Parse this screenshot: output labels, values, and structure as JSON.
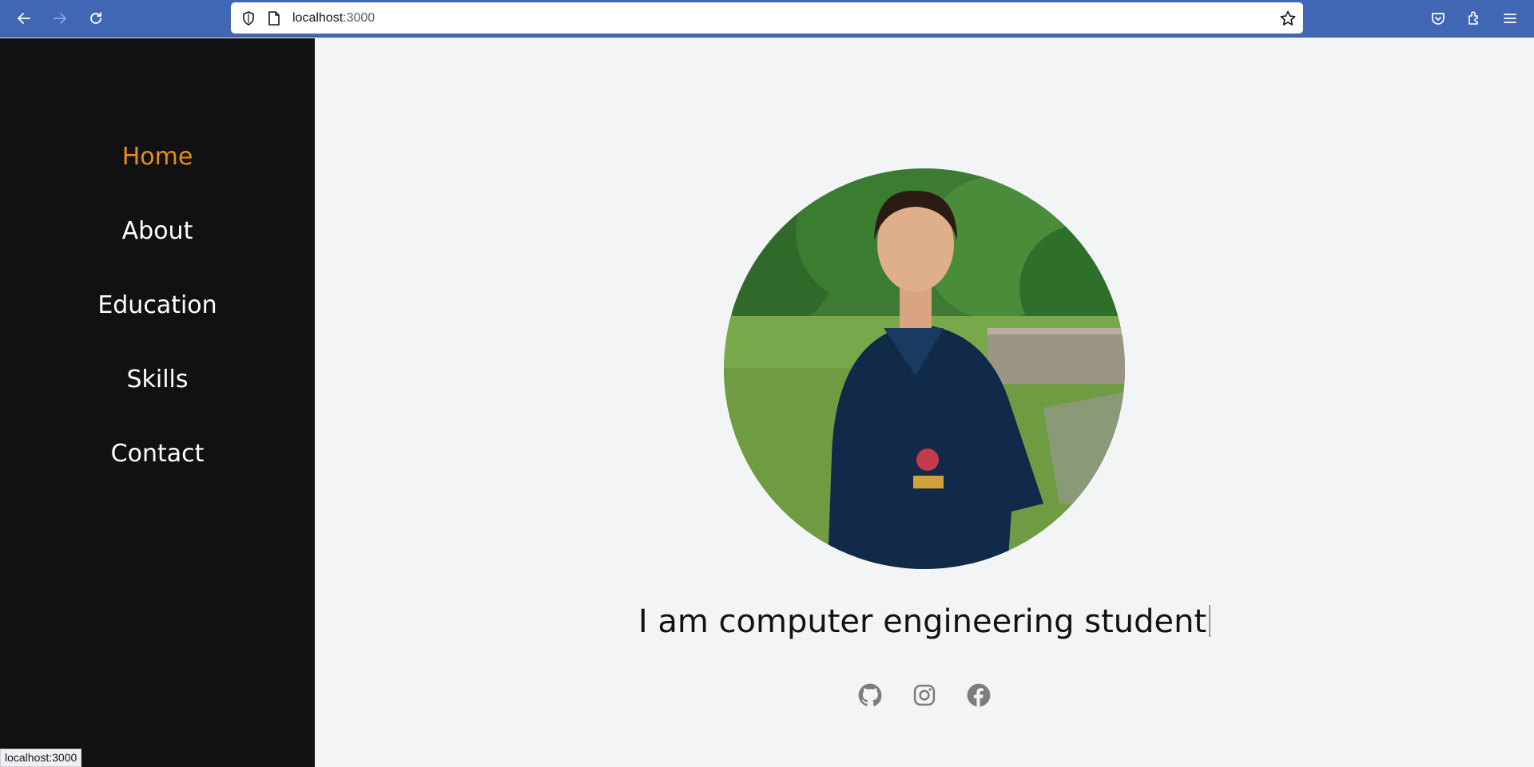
{
  "browser": {
    "url_host": "localhost",
    "url_port": ":3000",
    "back_icon": "back-arrow-icon",
    "forward_icon": "forward-arrow-icon",
    "reload_icon": "reload-icon",
    "status_text": "localhost:3000"
  },
  "sidebar": {
    "items": [
      {
        "label": "Home",
        "active": true
      },
      {
        "label": "About",
        "active": false
      },
      {
        "label": "Education",
        "active": false
      },
      {
        "label": "Skills",
        "active": false
      },
      {
        "label": "Contact",
        "active": false
      }
    ]
  },
  "hero": {
    "tagline": "I am computer engineering student",
    "social": [
      "github-icon",
      "instagram-icon",
      "facebook-icon"
    ]
  },
  "colors": {
    "toolbar": "#4166b4",
    "sidebar_bg": "#111111",
    "active_menu": "#e58e18",
    "main_bg": "#f3f4f6"
  }
}
